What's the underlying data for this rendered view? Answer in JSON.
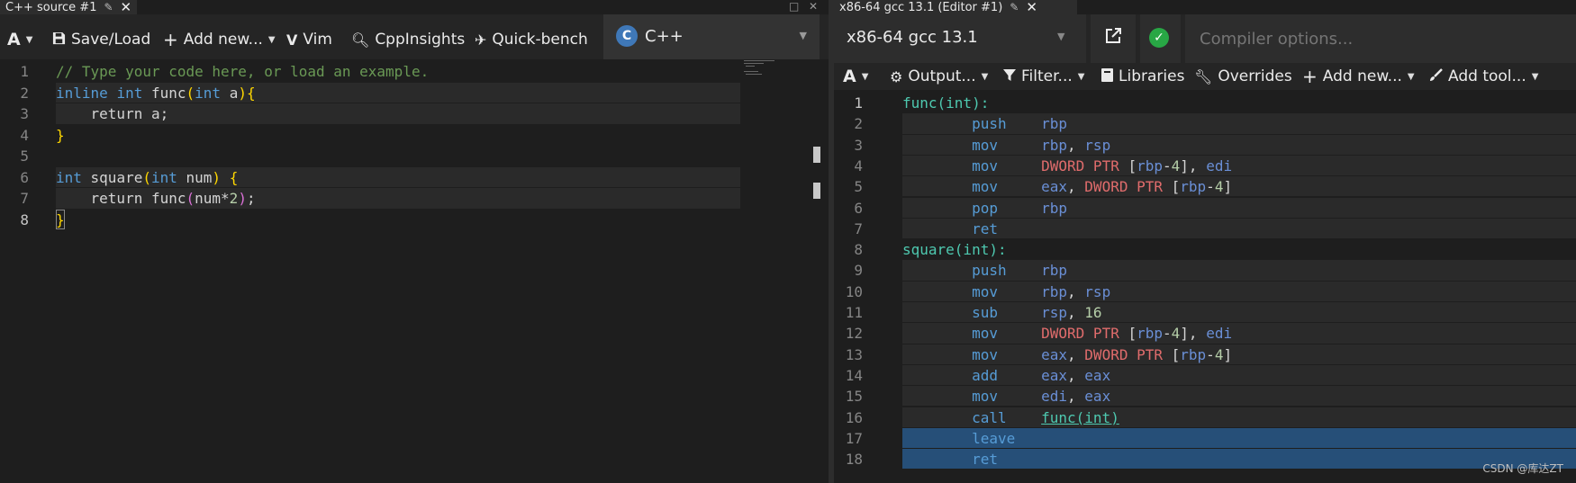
{
  "left": {
    "tab_title": "C++ source #1",
    "toolbar": {
      "font_label": "A",
      "save_load": "Save/Load",
      "add_new": "Add new...",
      "vim": "Vim",
      "cppinsights": "CppInsights",
      "quickbench": "Quick-bench",
      "language": "C++"
    },
    "lines": [
      {
        "n": "1",
        "tokens": [
          {
            "t": "// Type your code here, or load an example.",
            "c": "com"
          }
        ]
      },
      {
        "n": "2",
        "tokens": [
          {
            "t": "inline",
            "c": "kw"
          },
          {
            "t": " ",
            "c": "pl"
          },
          {
            "t": "int",
            "c": "kw"
          },
          {
            "t": " func",
            "c": "id"
          },
          {
            "t": "(",
            "c": "br"
          },
          {
            "t": "int",
            "c": "kw"
          },
          {
            "t": " a",
            "c": "id"
          },
          {
            "t": ")",
            "c": "br"
          },
          {
            "t": "{",
            "c": "br"
          }
        ]
      },
      {
        "n": "3",
        "tokens": [
          {
            "t": "    return a;",
            "c": "id"
          }
        ]
      },
      {
        "n": "4",
        "tokens": [
          {
            "t": "}",
            "c": "br"
          }
        ]
      },
      {
        "n": "5",
        "tokens": []
      },
      {
        "n": "6",
        "tokens": [
          {
            "t": "int",
            "c": "kw"
          },
          {
            "t": " square",
            "c": "id"
          },
          {
            "t": "(",
            "c": "br"
          },
          {
            "t": "int",
            "c": "kw"
          },
          {
            "t": " num",
            "c": "id"
          },
          {
            "t": ")",
            "c": "br"
          },
          {
            "t": " ",
            "c": "pl"
          },
          {
            "t": "{",
            "c": "br"
          }
        ]
      },
      {
        "n": "7",
        "tokens": [
          {
            "t": "    return func",
            "c": "id"
          },
          {
            "t": "(",
            "c": "br2"
          },
          {
            "t": "num*",
            "c": "id"
          },
          {
            "t": "2",
            "c": "num"
          },
          {
            "t": ")",
            "c": "br2"
          },
          {
            "t": ";",
            "c": "id"
          }
        ]
      },
      {
        "n": "8",
        "tokens": [
          {
            "t": "}",
            "c": "br"
          }
        ]
      }
    ]
  },
  "right": {
    "tab_title": "x86-64 gcc 13.1 (Editor #1)",
    "compiler_name": "x86-64 gcc 13.1",
    "compiler_options_placeholder": "Compiler options...",
    "toolbar": {
      "font_label": "A",
      "output": "Output...",
      "filter": "Filter...",
      "libraries": "Libraries",
      "overrides": "Overrides",
      "add_new": "Add new...",
      "add_tool": "Add tool..."
    },
    "lines": [
      {
        "n": "1",
        "tokens": [
          {
            "t": "func(int):",
            "c": "label"
          }
        ]
      },
      {
        "n": "2",
        "tokens": [
          {
            "t": "        push",
            "c": "mn"
          },
          {
            "t": "    rbp",
            "c": "reg"
          }
        ]
      },
      {
        "n": "3",
        "tokens": [
          {
            "t": "        mov",
            "c": "mn"
          },
          {
            "t": "     rbp",
            "c": "reg"
          },
          {
            "t": ", ",
            "c": "pl"
          },
          {
            "t": "rsp",
            "c": "reg"
          }
        ]
      },
      {
        "n": "4",
        "tokens": [
          {
            "t": "        mov",
            "c": "mn"
          },
          {
            "t": "     DWORD PTR ",
            "c": "ptr"
          },
          {
            "t": "[",
            "c": "pl"
          },
          {
            "t": "rbp",
            "c": "reg"
          },
          {
            "t": "-",
            "c": "pl"
          },
          {
            "t": "4",
            "c": "num"
          },
          {
            "t": "], ",
            "c": "pl"
          },
          {
            "t": "edi",
            "c": "reg"
          }
        ]
      },
      {
        "n": "5",
        "tokens": [
          {
            "t": "        mov",
            "c": "mn"
          },
          {
            "t": "     eax",
            "c": "reg"
          },
          {
            "t": ", ",
            "c": "pl"
          },
          {
            "t": "DWORD PTR ",
            "c": "ptr"
          },
          {
            "t": "[",
            "c": "pl"
          },
          {
            "t": "rbp",
            "c": "reg"
          },
          {
            "t": "-",
            "c": "pl"
          },
          {
            "t": "4",
            "c": "num"
          },
          {
            "t": "]",
            "c": "pl"
          }
        ]
      },
      {
        "n": "6",
        "tokens": [
          {
            "t": "        pop",
            "c": "mn"
          },
          {
            "t": "     rbp",
            "c": "reg"
          }
        ]
      },
      {
        "n": "7",
        "tokens": [
          {
            "t": "        ret",
            "c": "mn"
          }
        ]
      },
      {
        "n": "8",
        "tokens": [
          {
            "t": "square(int):",
            "c": "label"
          }
        ]
      },
      {
        "n": "9",
        "tokens": [
          {
            "t": "        push",
            "c": "mn"
          },
          {
            "t": "    rbp",
            "c": "reg"
          }
        ]
      },
      {
        "n": "10",
        "tokens": [
          {
            "t": "        mov",
            "c": "mn"
          },
          {
            "t": "     rbp",
            "c": "reg"
          },
          {
            "t": ", ",
            "c": "pl"
          },
          {
            "t": "rsp",
            "c": "reg"
          }
        ]
      },
      {
        "n": "11",
        "tokens": [
          {
            "t": "        sub",
            "c": "mn"
          },
          {
            "t": "     rsp",
            "c": "reg"
          },
          {
            "t": ", ",
            "c": "pl"
          },
          {
            "t": "16",
            "c": "num"
          }
        ]
      },
      {
        "n": "12",
        "tokens": [
          {
            "t": "        mov",
            "c": "mn"
          },
          {
            "t": "     DWORD PTR ",
            "c": "ptr"
          },
          {
            "t": "[",
            "c": "pl"
          },
          {
            "t": "rbp",
            "c": "reg"
          },
          {
            "t": "-",
            "c": "pl"
          },
          {
            "t": "4",
            "c": "num"
          },
          {
            "t": "], ",
            "c": "pl"
          },
          {
            "t": "edi",
            "c": "reg"
          }
        ]
      },
      {
        "n": "13",
        "tokens": [
          {
            "t": "        mov",
            "c": "mn"
          },
          {
            "t": "     eax",
            "c": "reg"
          },
          {
            "t": ", ",
            "c": "pl"
          },
          {
            "t": "DWORD PTR ",
            "c": "ptr"
          },
          {
            "t": "[",
            "c": "pl"
          },
          {
            "t": "rbp",
            "c": "reg"
          },
          {
            "t": "-",
            "c": "pl"
          },
          {
            "t": "4",
            "c": "num"
          },
          {
            "t": "]",
            "c": "pl"
          }
        ]
      },
      {
        "n": "14",
        "tokens": [
          {
            "t": "        add",
            "c": "mn"
          },
          {
            "t": "     eax",
            "c": "reg"
          },
          {
            "t": ", ",
            "c": "pl"
          },
          {
            "t": "eax",
            "c": "reg"
          }
        ]
      },
      {
        "n": "15",
        "tokens": [
          {
            "t": "        mov",
            "c": "mn"
          },
          {
            "t": "     edi",
            "c": "reg"
          },
          {
            "t": ", ",
            "c": "pl"
          },
          {
            "t": "eax",
            "c": "reg"
          }
        ]
      },
      {
        "n": "16",
        "tokens": [
          {
            "t": "        call",
            "c": "mn"
          },
          {
            "t": "    ",
            "c": "pl"
          },
          {
            "t": "func(int)",
            "c": "link"
          }
        ]
      },
      {
        "n": "17",
        "tokens": [
          {
            "t": "        leave",
            "c": "mn"
          }
        ]
      },
      {
        "n": "18",
        "tokens": [
          {
            "t": "        ret",
            "c": "mn"
          }
        ]
      }
    ]
  },
  "watermark": "CSDN @库达ZT",
  "colors": {
    "accent": "#4ec9b0",
    "selection": "#264f78",
    "ok": "#28a745"
  }
}
